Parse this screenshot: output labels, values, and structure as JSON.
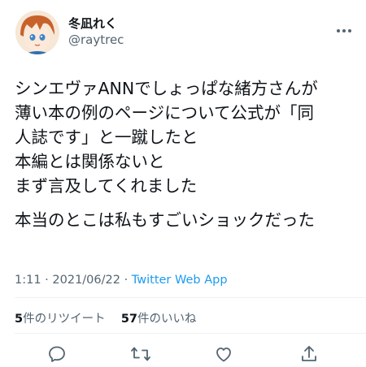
{
  "user": {
    "display_name": "冬凪れく",
    "handle": "@raytrec",
    "avatar": "avatar-illustration"
  },
  "tweet": {
    "lines": [
      "シンエヴァANNでしょっぱな緒方さんが",
      "薄い本の例のページについて公式が「同",
      "人誌です」と一蹴したと",
      "本編とは関係ないと",
      "まず言及してくれました"
    ],
    "lines2": [
      "本当のとこは私もすごいショックだった"
    ]
  },
  "meta": {
    "time": "1:11",
    "sep1": " · ",
    "date": "2021/06/22",
    "sep2": " · ",
    "source": "Twitter Web App"
  },
  "stats": {
    "retweets": "5",
    "retweets_label": "件のリツイート",
    "likes": "57",
    "likes_label": "件のいいね"
  },
  "icons": [
    "more-icon",
    "reply-icon",
    "retweet-icon",
    "like-icon",
    "share-icon"
  ],
  "colors": {
    "link": "#1d9bf0",
    "muted": "#536471",
    "text": "#0f1419"
  }
}
